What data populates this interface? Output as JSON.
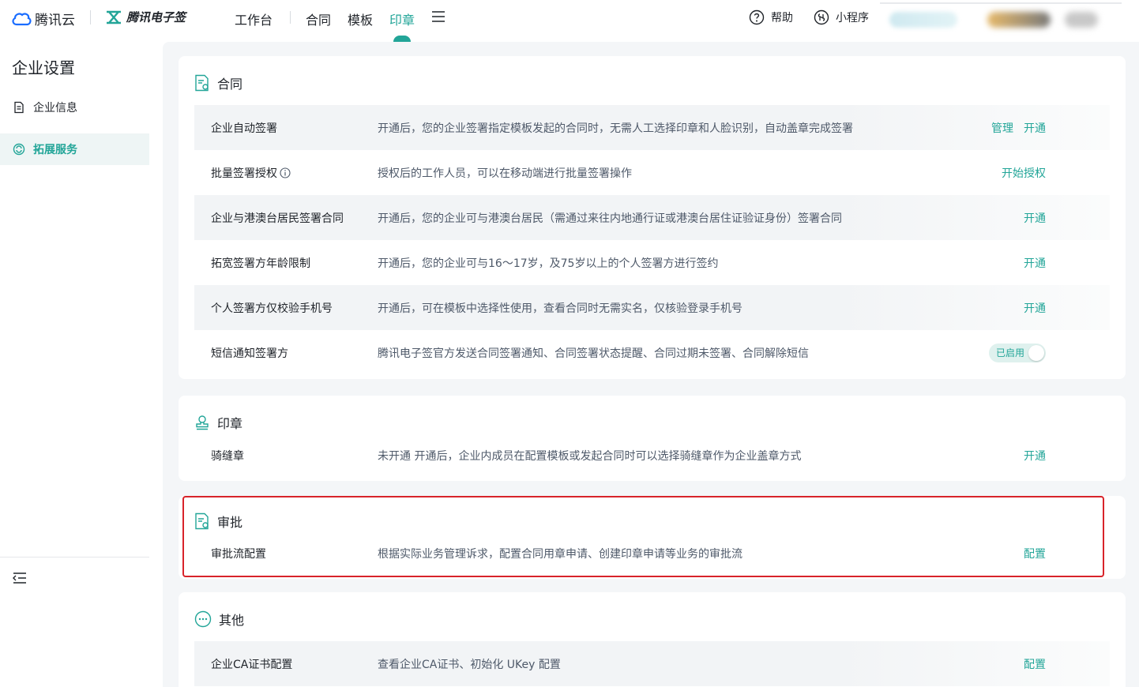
{
  "header": {
    "cloud_brand": "腾讯云",
    "esign_brand": "腾讯电子签",
    "nav": [
      "工作台",
      "合同",
      "模板",
      "印章"
    ],
    "active_nav": "印章",
    "help": "帮助",
    "mini_program": "小程序"
  },
  "sidebar": {
    "title": "企业设置",
    "items": [
      {
        "label": "企业信息",
        "icon": "document-icon"
      },
      {
        "label": "拓展服务",
        "icon": "service-icon",
        "active": true
      }
    ]
  },
  "sections": {
    "contract": {
      "title": "合同",
      "rows": [
        {
          "name": "企业自动签署",
          "desc": "开通后，您的企业签署指定模板发起的合同时，无需人工选择印章和人脸识别，自动盖章完成签署",
          "actions": [
            "管理",
            "开通"
          ]
        },
        {
          "name": "批量签署授权",
          "desc": "授权后的工作人员，可以在移动端进行批量签署操作",
          "actions": [
            "开始授权"
          ]
        },
        {
          "name": "企业与港澳台居民签署合同",
          "desc": "开通后，您的企业可与港澳台居民（需通过来往内地通行证或港澳台居住证验证身份）签署合同",
          "actions": [
            "开通"
          ]
        },
        {
          "name": "拓宽签署方年龄限制",
          "desc": "开通后，您的企业可与16～17岁，及75岁以上的个人签署方进行签约",
          "actions": [
            "开通"
          ]
        },
        {
          "name": "个人签署方仅校验手机号",
          "desc": "开通后，可在模板中选择性使用，查看合同时无需实名，仅核验登录手机号",
          "actions": [
            "开通"
          ]
        },
        {
          "name": "短信通知签署方",
          "desc": "腾讯电子签官方发送合同签署通知、合同签署状态提醒、合同过期未签署、合同解除短信",
          "toggle": "已启用"
        }
      ]
    },
    "seal": {
      "title": "印章",
      "rows": [
        {
          "name": "骑缝章",
          "desc": "未开通    开通后，企业内成员在配置模板或发起合同时可以选择骑缝章作为企业盖章方式",
          "actions": [
            "开通"
          ]
        }
      ]
    },
    "approval": {
      "title": "审批",
      "rows": [
        {
          "name": "审批流配置",
          "desc": "根据实际业务管理诉求，配置合同用章申请、创建印章申请等业务的审批流",
          "actions": [
            "配置"
          ]
        }
      ]
    },
    "other": {
      "title": "其他",
      "rows": [
        {
          "name": "企业CA证书配置",
          "desc": "查看企业CA证书、初始化 UKey 配置",
          "actions": [
            "配置"
          ]
        }
      ]
    }
  },
  "colors": {
    "accent": "#22a598",
    "highlight": "#d8232a"
  }
}
